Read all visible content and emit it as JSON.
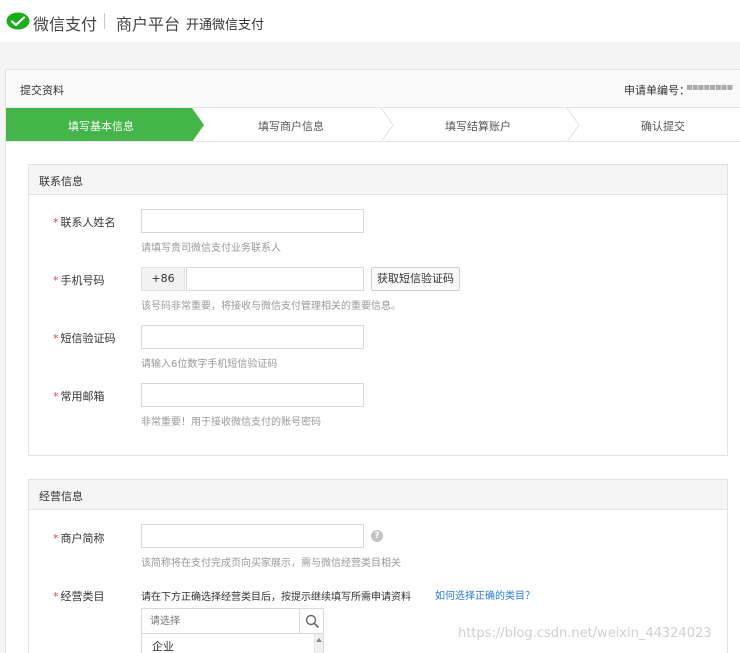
{
  "header": {
    "brand": "微信支付",
    "platform": "商户平台",
    "subtitle": "开通微信支付"
  },
  "panel": {
    "title": "提交资料",
    "application_no_label": "申请单编号：",
    "application_no_value": "▪▪▪▪▪▪▪▪"
  },
  "steps": [
    {
      "label": "填写基本信息",
      "active": true
    },
    {
      "label": "填写商户信息",
      "active": false
    },
    {
      "label": "填写结算账户",
      "active": false
    },
    {
      "label": "确认提交",
      "active": false
    }
  ],
  "contact": {
    "title": "联系信息",
    "required_mark": "*",
    "name": {
      "label": "联系人姓名",
      "value": "",
      "hint": "请填写贵司微信支付业务联系人"
    },
    "phone": {
      "label": "手机号码",
      "prefix": "+86",
      "value": "",
      "button": "获取短信验证码",
      "hint": "该号码非常重要，将接收与微信支付管理相关的重要信息。"
    },
    "sms": {
      "label": "短信验证码",
      "value": "",
      "hint": "请输入6位数字手机短信验证码"
    },
    "email": {
      "label": "常用邮箱",
      "value": "",
      "hint": "非常重要！用于接收微信支付的账号密码"
    }
  },
  "business": {
    "title": "经营信息",
    "short_name": {
      "label": "商户简称",
      "value": "",
      "help": "?",
      "hint": "该简称将在支付完成页向买家展示，需与微信经营类目相关"
    },
    "category": {
      "label": "经营类目",
      "instruction": "请在下方正确选择经营类目后，按提示继续填写所需申请资料",
      "link": "如何选择正确的类目？",
      "search_placeholder": "请选择",
      "options": [
        "企业"
      ]
    }
  },
  "watermark": "https://blog.csdn.net/weixin_44324023",
  "colors": {
    "accent": "#44b549",
    "required": "#e0483e",
    "link": "#2a7bd5"
  }
}
